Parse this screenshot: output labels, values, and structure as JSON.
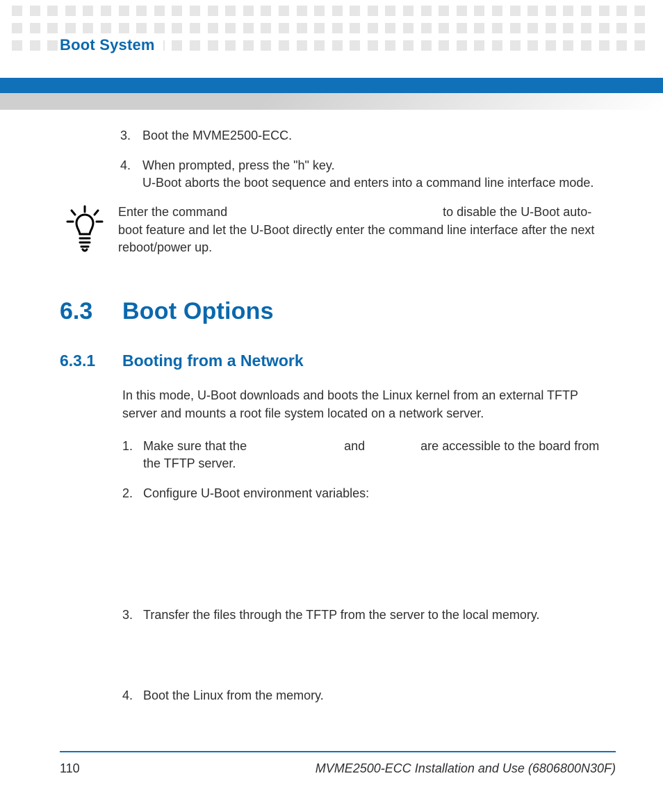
{
  "header": {
    "page_title": "Boot System"
  },
  "steps_top": {
    "s3_num": "3.",
    "s3_text": "Boot the MVME2500-ECC.",
    "s4_num": "4.",
    "s4_line1": "When prompted, press the \"h\" key.",
    "s4_line2": "U-Boot aborts the boot sequence and enters into a command line interface mode."
  },
  "tip": {
    "pre": " Enter the command ",
    "post": " to disable the U-Boot auto-boot feature and let the U-Boot directly enter the command line interface after the next reboot/power up."
  },
  "section": {
    "num": "6.3",
    "title": "Boot Options"
  },
  "subsection": {
    "num": "6.3.1",
    "title": "Booting from a Network"
  },
  "intro_para": "In this mode, U-Boot downloads and boots the Linux kernel from an external TFTP server and mounts a root file system located on a network server.",
  "net_steps": {
    "s1_num": "1.",
    "s1_pre": "Make sure that the ",
    "s1_mid": " and ",
    "s1_post": " are accessible to the board from the TFTP server.",
    "s2_num": "2.",
    "s2_text": "Configure U-Boot environment variables:",
    "s3_num": "3.",
    "s3_text": "Transfer the files through the TFTP from the server to the local memory.",
    "s4_num": "4.",
    "s4_text": "Boot the Linux from the memory."
  },
  "footer": {
    "page_num": "110",
    "doc_ref": "MVME2500-ECC Installation and Use (6806800N30F)"
  }
}
